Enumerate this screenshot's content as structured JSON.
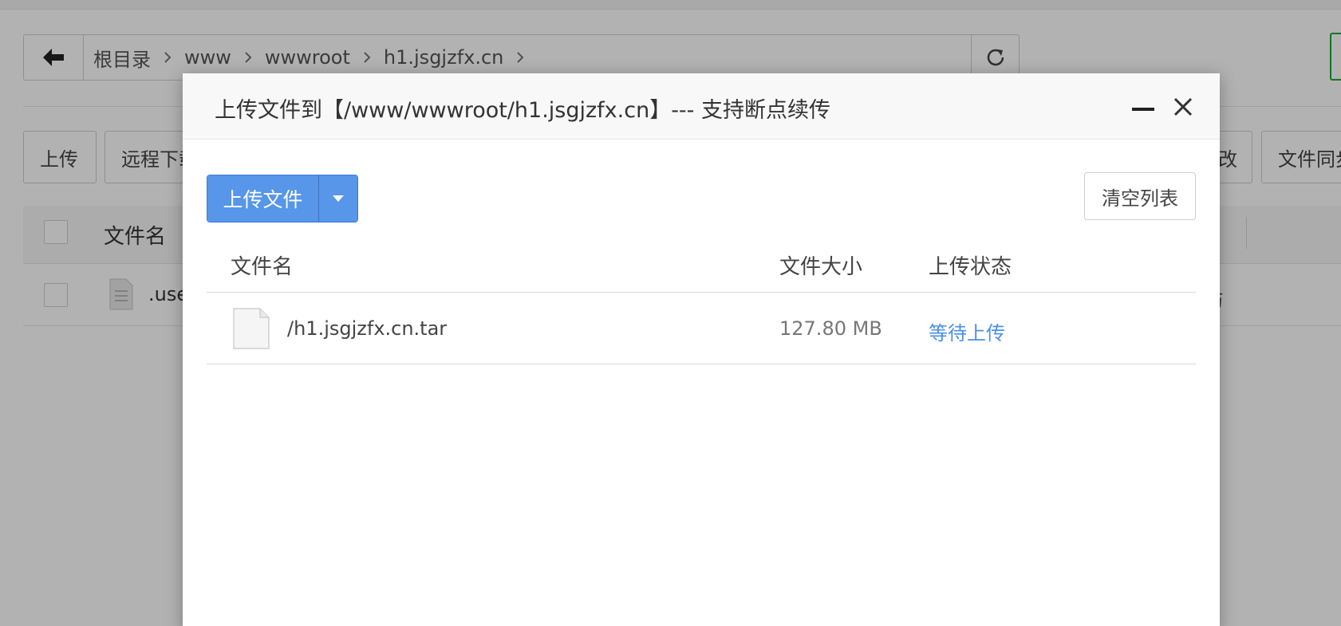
{
  "background": {
    "breadcrumb": [
      "根目录",
      "www",
      "wwwroot",
      "h1.jsgjzfx.cn"
    ],
    "toolbar": {
      "upload": "上传",
      "remote_download": "远程下载",
      "modify_partial": "改",
      "file_sync_partial": "文件同步"
    },
    "table": {
      "name_header": "文件名",
      "row_name_partial": ".use",
      "row_note_partial": "(防"
    }
  },
  "modal": {
    "title": "上传文件到【/www/wwwroot/h1.jsgjzfx.cn】--- 支持断点续传",
    "upload_button": "上传文件",
    "clear_button": "清空列表",
    "columns": {
      "name": "文件名",
      "size": "文件大小",
      "status": "上传状态"
    },
    "files": [
      {
        "name": "/h1.jsgjzfx.cn.tar",
        "size": "127.80 MB",
        "status": "等待上传"
      }
    ]
  },
  "colors": {
    "primary": "#5796e8",
    "status_link": "#4a8fe7",
    "green_accent": "#20a53a"
  },
  "icons": {
    "back": "arrow-left-icon",
    "refresh": "refresh-icon",
    "minimize": "minimize-icon",
    "close": "close-icon",
    "dropdown": "caret-down-icon",
    "file": "file-icon"
  }
}
